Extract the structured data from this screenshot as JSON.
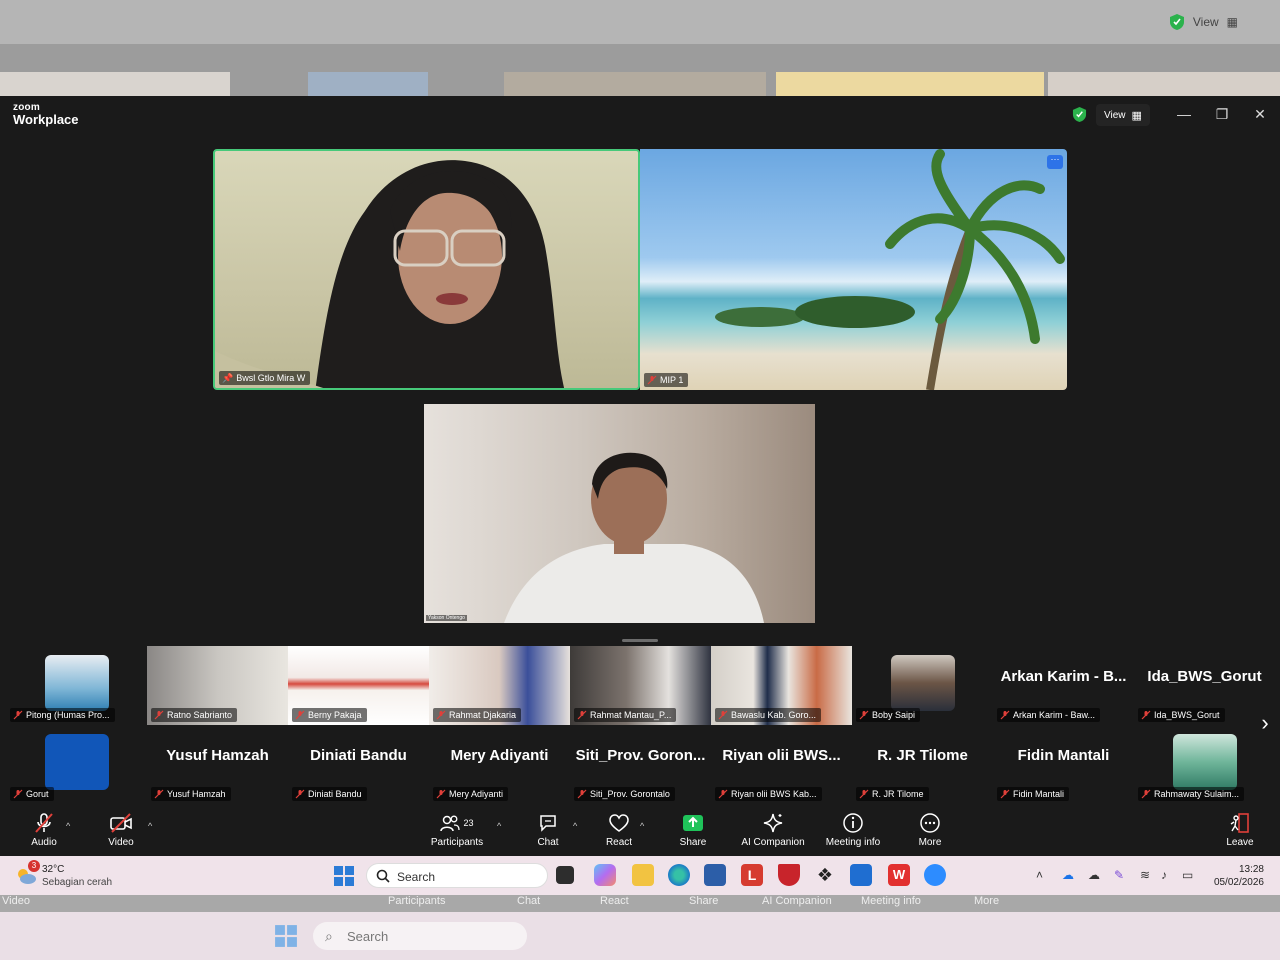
{
  "outer_window": {
    "view_label": "View",
    "bottom_labels": [
      "Video",
      "Participants",
      "Chat",
      "React",
      "Share",
      "AI Companion",
      "Meeting info",
      "More"
    ],
    "taskbar_search": "Search"
  },
  "titlebar": {
    "brand_small": "zoom",
    "brand_big": "Workplace",
    "view_label": "View",
    "minimize": "—",
    "restore": "❐",
    "close": "✕"
  },
  "main_videos": [
    {
      "name": "Bwsl Gtlo Mira W"
    },
    {
      "name": "MIP 1"
    },
    {
      "name": "Yakson Ontengo"
    }
  ],
  "gallery_row1": [
    {
      "display": "avatar",
      "name": "Pitong (Humas Pro..."
    },
    {
      "display": "photo",
      "name": "Ratno Sabrianto"
    },
    {
      "display": "photo",
      "name": "Berny Pakaja"
    },
    {
      "display": "photo",
      "name": "Rahmat Djakaria"
    },
    {
      "display": "photo",
      "name": "Rahmat Mantau_P..."
    },
    {
      "display": "photo",
      "name": "Bawaslu Kab. Goro..."
    },
    {
      "display": "avatar",
      "name": "Boby Saipi"
    },
    {
      "display": "text",
      "big": "Arkan Karim - B...",
      "name": "Arkan Karim - Baw..."
    },
    {
      "display": "text",
      "big": "Ida_BWS_Gorut",
      "name": "Ida_BWS_Gorut"
    }
  ],
  "gallery_row2": [
    {
      "display": "avatar",
      "name": "Gorut"
    },
    {
      "display": "text",
      "big": "Yusuf Hamzah",
      "name": "Yusuf Hamzah"
    },
    {
      "display": "text",
      "big": "Diniati Bandu",
      "name": "Diniati Bandu"
    },
    {
      "display": "text",
      "big": "Mery Adiyanti",
      "name": "Mery Adiyanti"
    },
    {
      "display": "text",
      "big": "Siti_Prov. Goron...",
      "name": "Siti_Prov. Gorontalo"
    },
    {
      "display": "text",
      "big": "Riyan olii BWS...",
      "name": "Riyan olii BWS Kab..."
    },
    {
      "display": "text",
      "big": "R. JR Tilome",
      "name": "R. JR Tilome"
    },
    {
      "display": "text",
      "big": "Fidin Mantali",
      "name": "Fidin Mantali"
    },
    {
      "display": "avatar",
      "name": "Rahmawaty Sulaim..."
    }
  ],
  "toolbar": {
    "audio": "Audio",
    "video": "Video",
    "participants": "Participants",
    "participants_count": "23",
    "chat": "Chat",
    "react": "React",
    "share": "Share",
    "ai_companion": "AI Companion",
    "meeting_info": "Meeting info",
    "more": "More",
    "leave": "Leave"
  },
  "taskbar": {
    "weather_temp": "32°C",
    "weather_condition": "Sebagian cerah",
    "weather_badge": "3",
    "search_label": "Search",
    "time": "13:28",
    "date": "05/02/2026"
  },
  "colors": {
    "active_speaker_border": "#47c97a",
    "share_green": "#1fc35a",
    "mute_red": "#e0403a"
  }
}
